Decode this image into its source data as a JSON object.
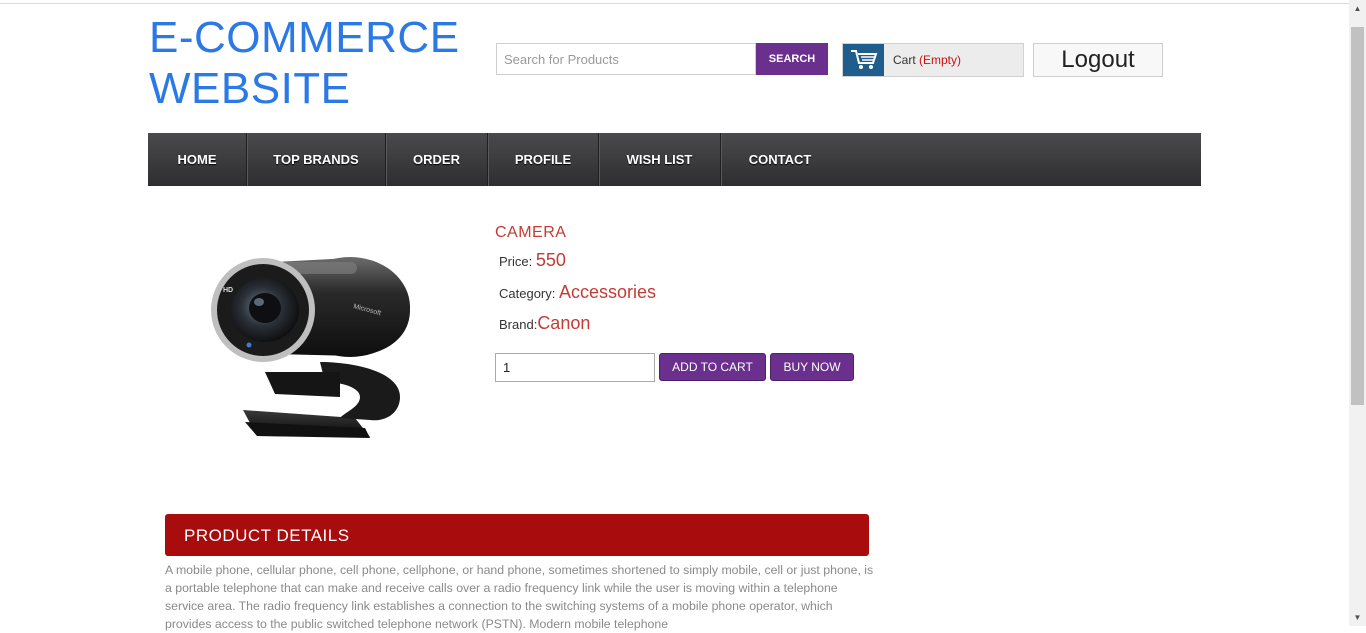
{
  "header": {
    "logo_line1": "E-COMMERCE",
    "logo_line2": "WEBSITE",
    "search_placeholder": "Search for Products",
    "search_button": "SEARCH",
    "cart_label": "Cart",
    "cart_status": "(Empty)",
    "logout_label": "Logout"
  },
  "nav": {
    "items": [
      {
        "label": "HOME"
      },
      {
        "label": "TOP BRANDS"
      },
      {
        "label": "ORDER"
      },
      {
        "label": "PROFILE"
      },
      {
        "label": "WISH LIST"
      },
      {
        "label": "CONTACT"
      }
    ]
  },
  "product": {
    "image_icon": "webcam-image",
    "name": "CAMERA",
    "price_label": "Price:",
    "price": "550",
    "category_label": "Category:",
    "category": "Accessories",
    "brand_label": "Brand:",
    "brand": "Canon",
    "quantity": "1",
    "add_to_cart": "ADD TO CART",
    "buy_now": "BUY NOW"
  },
  "details": {
    "heading": "PRODUCT DETAILS",
    "description": "A mobile phone, cellular phone, cell phone, cellphone, or hand phone, sometimes shortened to simply mobile, cell or just phone, is a portable telephone that can make and receive calls over a radio frequency link while the user is moving within a telephone service area. The radio frequency link establishes a connection to the switching systems of a mobile phone operator, which provides access to the public switched telephone network (PSTN). Modern mobile telephone"
  },
  "colors": {
    "logo": "#2b79e6",
    "accent_purple": "#6b2f8e",
    "accent_red": "#c43b35",
    "details_bar": "#a80c0c",
    "nav_bg": "#3a3a3c"
  }
}
